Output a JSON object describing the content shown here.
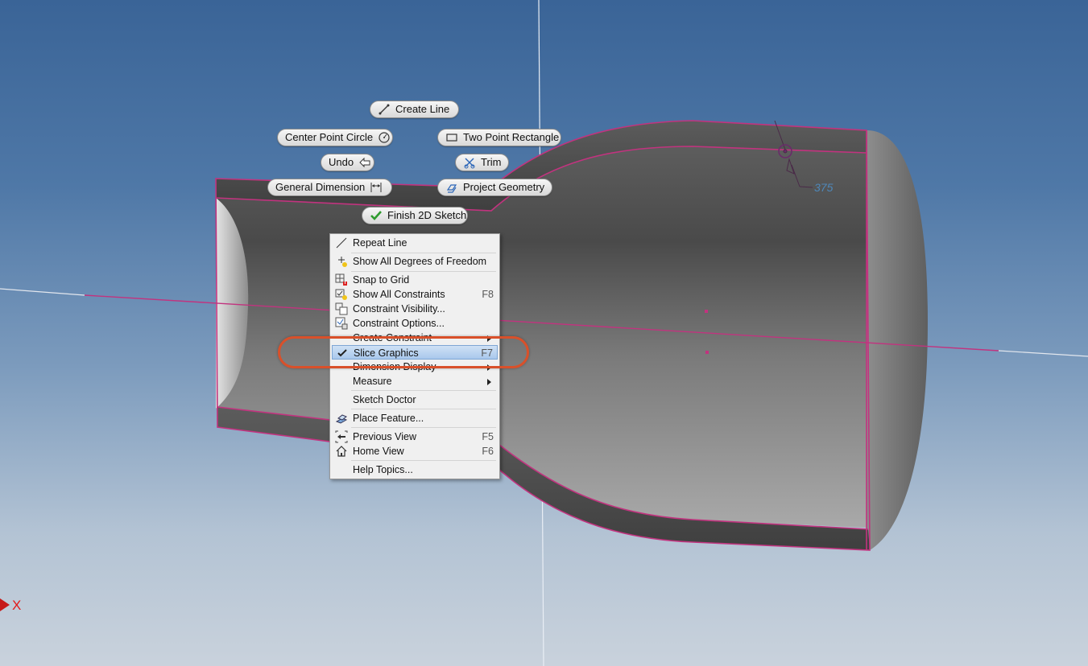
{
  "viewport": {
    "axis_label": "X",
    "dimension_value": "375"
  },
  "marking_menu": {
    "create_line": "Create Line",
    "center_point_circle": "Center Point Circle",
    "two_point_rectangle": "Two Point Rectangle",
    "undo": "Undo",
    "trim": "Trim",
    "general_dimension": "General Dimension",
    "project_geometry": "Project Geometry",
    "finish_sketch": "Finish 2D Sketch"
  },
  "context_menu": {
    "items": [
      {
        "label": "Repeat Line",
        "shortcut": "",
        "icon": "line-icon"
      },
      {
        "label": "Show All Degrees of Freedom",
        "shortcut": "",
        "icon": "dof-icon"
      },
      {
        "label": "Snap to Grid",
        "shortcut": "",
        "icon": "grid-magnet-icon"
      },
      {
        "label": "Show All Constraints",
        "shortcut": "F8",
        "icon": "constraints-icon"
      },
      {
        "label": "Constraint Visibility...",
        "shortcut": "",
        "icon": "constraint-visibility-icon"
      },
      {
        "label": "Constraint Options...",
        "shortcut": "",
        "icon": "constraint-options-icon"
      },
      {
        "label": "Create Constraint",
        "shortcut": "",
        "submenu": true
      },
      {
        "label": "Slice Graphics",
        "shortcut": "F7",
        "checked": true,
        "highlighted": true
      },
      {
        "label": "Dimension Display",
        "shortcut": "",
        "submenu": true
      },
      {
        "label": "Measure",
        "shortcut": "",
        "submenu": true
      },
      {
        "label": "Sketch Doctor",
        "shortcut": ""
      },
      {
        "label": "Place Feature...",
        "shortcut": "",
        "icon": "place-feature-icon"
      },
      {
        "label": "Previous View",
        "shortcut": "F5",
        "icon": "previous-view-icon"
      },
      {
        "label": "Home View",
        "shortcut": "F6",
        "icon": "home-icon"
      },
      {
        "label": "Help Topics...",
        "shortcut": ""
      }
    ]
  },
  "colors": {
    "sketch_line": "#c2337f",
    "highlight_ring": "#d9502a",
    "axis_x": "#e31b1b"
  }
}
